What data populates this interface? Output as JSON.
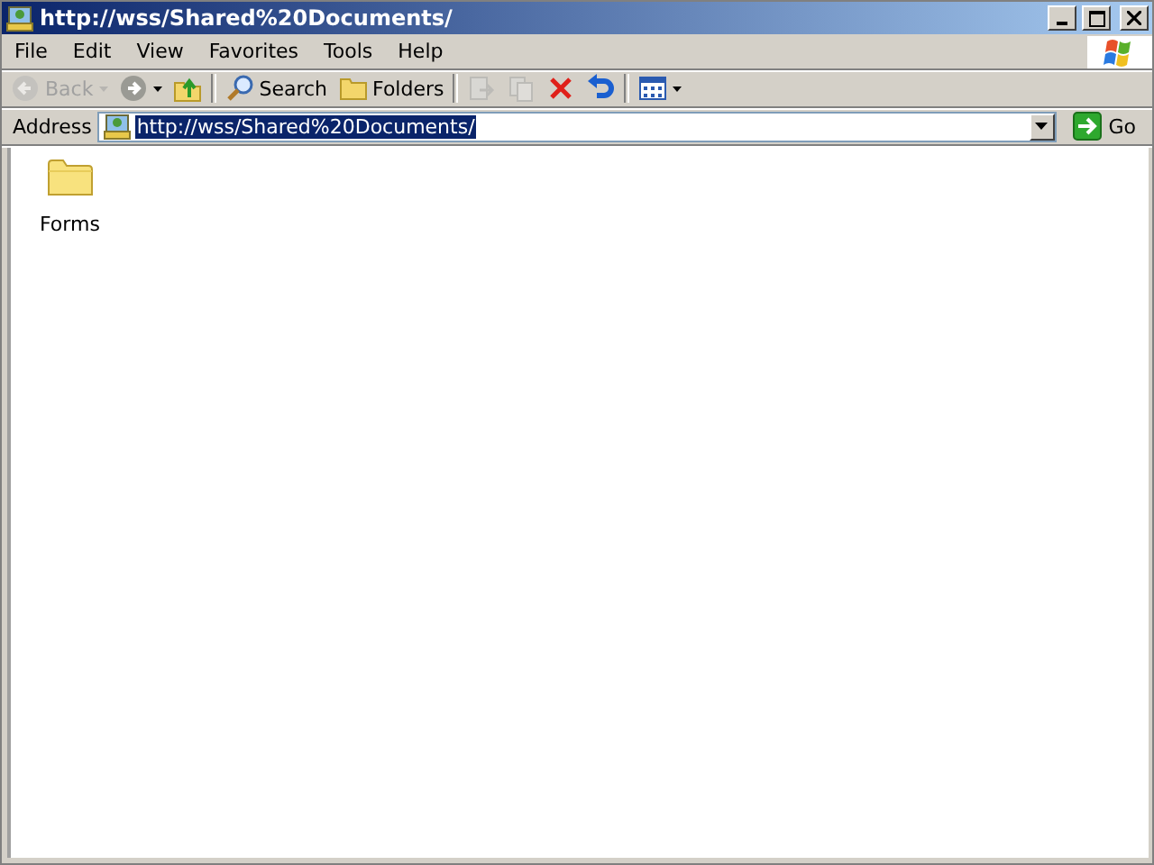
{
  "window": {
    "title": "http://wss/Shared%20Documents/"
  },
  "menu": [
    {
      "label": "File"
    },
    {
      "label": "Edit"
    },
    {
      "label": "View"
    },
    {
      "label": "Favorites"
    },
    {
      "label": "Tools"
    },
    {
      "label": "Help"
    }
  ],
  "toolbar": [
    {
      "kind": "back",
      "label": "Back",
      "disabled": true
    },
    {
      "kind": "forward",
      "disabled": false
    },
    {
      "kind": "up",
      "disabled": false
    },
    {
      "kind": "search",
      "label": "Search",
      "disabled": false
    },
    {
      "kind": "folders",
      "label": "Folders",
      "disabled": false
    },
    {
      "kind": "move",
      "disabled": true
    },
    {
      "kind": "copy",
      "disabled": true
    },
    {
      "kind": "delete",
      "disabled": false
    },
    {
      "kind": "undo",
      "disabled": false
    },
    {
      "kind": "views",
      "disabled": false
    }
  ],
  "address": {
    "label": "Address",
    "value": "http://wss/Shared%20Documents/",
    "selected": true,
    "go": "Go"
  },
  "items": [
    {
      "label": "Forms"
    }
  ]
}
